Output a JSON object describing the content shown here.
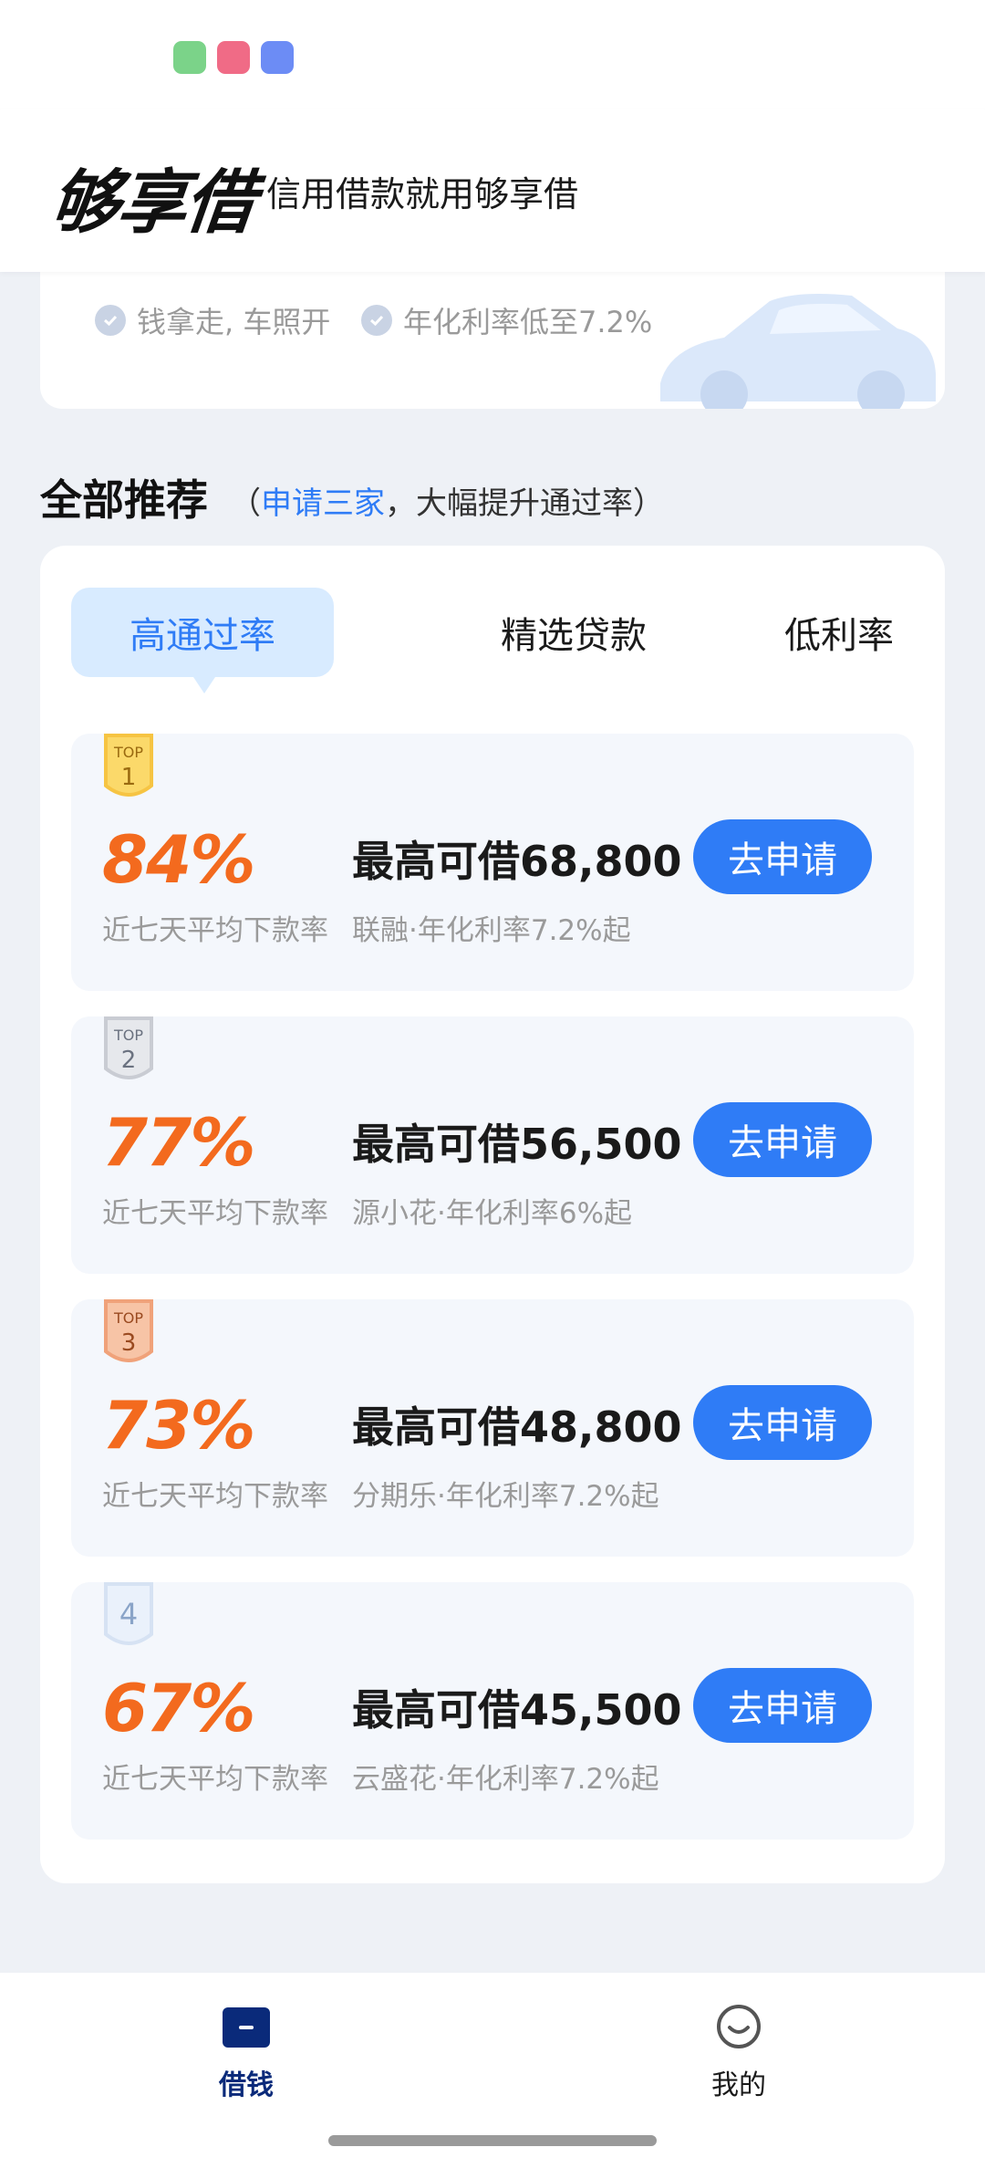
{
  "status_bar": {
    "icons": [
      "messages-app-icon",
      "photo-app-icon",
      "chat-app-icon"
    ],
    "icon_colors": [
      "#7bd389",
      "#f06b86",
      "#6c8cf5"
    ]
  },
  "header": {
    "brand": "够享借",
    "slogan": "信用借款就用够享借"
  },
  "promo": {
    "features": [
      "钱拿走, 车照开",
      "年化利率低至7.2%"
    ]
  },
  "section": {
    "title": "全部推荐",
    "subtitle_open": "（",
    "subtitle_highlight": "申请三家",
    "subtitle_rest": "，大幅提升通过率）"
  },
  "tabs": [
    {
      "label": "高通过率",
      "active": true
    },
    {
      "label": "精选贷款",
      "active": false
    },
    {
      "label": "低利率",
      "active": false
    }
  ],
  "products": [
    {
      "rank": "1",
      "medal": "gold",
      "rate": "84%",
      "rate_label": "近七天平均下款率",
      "amount": "最高可借68,800",
      "lender": "联融·年化利率7.2%起",
      "button": "去申请"
    },
    {
      "rank": "2",
      "medal": "silver",
      "rate": "77%",
      "rate_label": "近七天平均下款率",
      "amount": "最高可借56,500",
      "lender": "源小花·年化利率6%起",
      "button": "去申请"
    },
    {
      "rank": "3",
      "medal": "bronze",
      "rate": "73%",
      "rate_label": "近七天平均下款率",
      "amount": "最高可借48,800",
      "lender": "分期乐·年化利率7.2%起",
      "button": "去申请"
    },
    {
      "rank": "4",
      "medal": "plain",
      "rate": "67%",
      "rate_label": "近七天平均下款率",
      "amount": "最高可借45,500",
      "lender": "云盛花·年化利率7.2%起",
      "button": "去申请"
    }
  ],
  "medal_top_text": "TOP",
  "nav": [
    {
      "label": "借钱",
      "icon": "wallet-icon",
      "active": true
    },
    {
      "label": "我的",
      "icon": "smiley-icon",
      "active": false
    }
  ],
  "colors": {
    "accent": "#2f7cf6",
    "rate": "#f36a1e",
    "nav_active": "#0a2a7a"
  }
}
